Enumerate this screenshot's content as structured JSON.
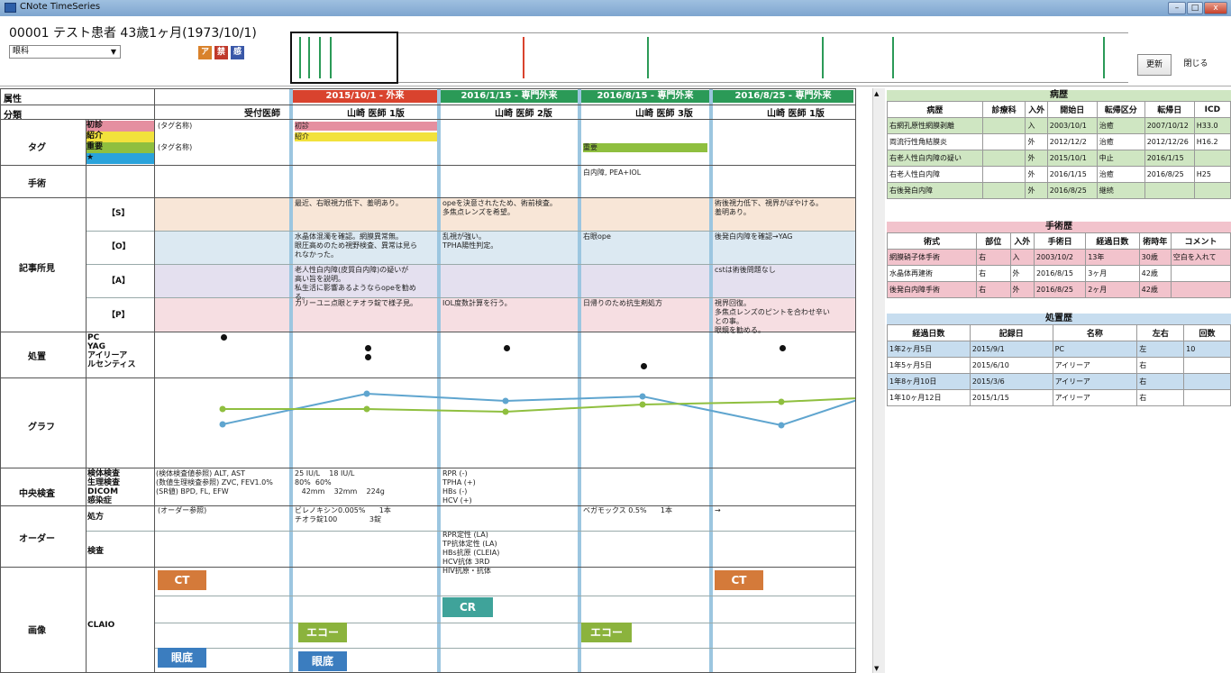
{
  "window": {
    "title": "CNote TimeSeries",
    "min": "–",
    "max": "□",
    "close": "x"
  },
  "patient": {
    "info": "00001 テスト患者 43歳1ヶ月(1973/10/1)",
    "department": "眼科",
    "badges": [
      {
        "label": "ア",
        "color": "#d9822b"
      },
      {
        "label": "禁",
        "color": "#c0392b"
      },
      {
        "label": "感",
        "color": "#3a58a8"
      }
    ]
  },
  "buttons": {
    "update": "更新",
    "close": "閉じる"
  },
  "grid": {
    "attr_label": "属性",
    "category_label": "分類",
    "doctor_col_label": "受付医師",
    "visits": [
      {
        "header": "2015/10/1 - 外来",
        "color": "#d9432e",
        "doctor": "山崎 医師 1版"
      },
      {
        "header": "2016/1/15 - 専門外来",
        "color": "#2b9a57",
        "doctor": "山崎 医師 2版"
      },
      {
        "header": "2016/8/15 - 専門外来",
        "color": "#2b9a57",
        "doctor": "山崎 医師 3版"
      },
      {
        "header": "2016/8/25 - 専門外来",
        "color": "#2b9a57",
        "doctor": "山崎 医師 1版"
      }
    ],
    "sections": {
      "tag": "タグ",
      "surgery": "手術",
      "findings": "記事所見",
      "treatment": "処置",
      "graph": "グラフ",
      "central_exam": "中央検査",
      "order": "オーダー",
      "image": "画像"
    },
    "tag_rows": [
      {
        "label": "初診",
        "color": "#e58fa0",
        "note": "(タグ名称)"
      },
      {
        "label": "紹介",
        "color": "#f2e23c",
        "note": ""
      },
      {
        "label": "重要",
        "color": "#8fbf3f",
        "note": "(タグ名称)"
      },
      {
        "label": "★",
        "color": "#2aa3db",
        "note": ""
      }
    ],
    "soap_rows": [
      "【S】",
      "【O】",
      "【A】",
      "【P】"
    ],
    "treatment_rows": [
      "PC",
      "YAG",
      "アイリーア",
      "ルセンティス"
    ],
    "exam_rows": [
      {
        "label": "検体検査",
        "note": "(検体検査値参照) ALT, AST"
      },
      {
        "label": "生理検査",
        "note": "(数値生理検査参照) ZVC, FEV1.0%"
      },
      {
        "label": "DICOM",
        "note": "(SR値) BPD, FL, EFW"
      },
      {
        "label": "感染症",
        "note": ""
      }
    ],
    "order_rows": [
      "処方",
      "検査"
    ],
    "order_note": "(オーダー参照)",
    "image_row": "CLAIO",
    "cells": {
      "tag_shoshin": "初診",
      "tag_shokai": "紹介",
      "tag_juyo": "重要",
      "surgery_v3": "白内障, PEA+IOL",
      "s_v1": "最近、右眼視力低下、羞明あり。",
      "s_v2": "opeを決意されたため、術前検査。\n多焦点レンズを希望。",
      "s_v4": "術後視力低下、視界がぼやける。\n羞明あり。",
      "o_v1": "水晶体混濁を確認。網膜異常無。\n眼圧高めのため視野検査、異常は見ら\nれなかった。",
      "o_v2": "乱視が強い。\nTPHA陽性判定。",
      "o_v3": "右眼ope",
      "o_v4": "後発白内障を確認→YAG",
      "a_v1": "老人性白内障(皮質白内障)の疑いが\n高い旨を説明。\n私生活に影響あるようならopeを勧め\nる。",
      "a_v3": "cstは術後問題なし",
      "p_v1": "カリーユニ点眼とチオラ錠で様子見。",
      "p_v2": "IOL度数計算を行う。",
      "p_v3": "日帰りのため抗生剤処方",
      "p_v4": "視界回復。\n多焦点レンズのピントを合わせ辛い\nとの事。\n眼鏡を勧める。",
      "exam_v1": "25 IU/L    18 IU/L\n80%  60%\n   42mm    32mm    224g",
      "exam_v2": "RPR (-)\nTPHA (+)\nHBs (-)\nHCV (+)",
      "rx_v1": "ビレノキシン0.005%      1本\nチオラ錠100              3錠",
      "rx_v3": "ベガモックス 0.5%      1本",
      "rx_v4": "→",
      "test_v2": "RPR定性 (LA)\nTP抗体定性 (LA)\nHBs抗原 (CLEIA)\nHCV抗体 3RD\nHIV抗原・抗体"
    },
    "images": [
      {
        "label": "CT",
        "color": "#d47a3a"
      },
      {
        "label": "エコー",
        "color": "#8bb33d"
      },
      {
        "label": "眼底",
        "color": "#3b7dbf"
      },
      {
        "label": "眼底",
        "color": "#3b7dbf"
      },
      {
        "label": "CR",
        "color": "#3fa39a"
      },
      {
        "label": "エコー",
        "color": "#8bb33d"
      },
      {
        "label": "CT",
        "color": "#d47a3a"
      }
    ]
  },
  "history": {
    "title": "病歴",
    "color": "#cfe6c2",
    "headers": [
      "病歴",
      "診療科",
      "入外",
      "開始日",
      "転帰区分",
      "転帰日",
      "ICD"
    ],
    "rows": [
      [
        "右網孔原性網膜剥離",
        "",
        "入",
        "2003/10/1",
        "治癒",
        "2007/10/12",
        "H33.0"
      ],
      [
        "両流行性角結膜炎",
        "",
        "外",
        "2012/12/2",
        "治癒",
        "2012/12/26",
        "H16.2"
      ],
      [
        "右老人性白内障の疑い",
        "",
        "外",
        "2015/10/1",
        "中止",
        "2016/1/15",
        ""
      ],
      [
        "右老人性白内障",
        "",
        "外",
        "2016/1/15",
        "治癒",
        "2016/8/25",
        "H25"
      ],
      [
        "右後発白内障",
        "",
        "外",
        "2016/8/25",
        "継続",
        "",
        ""
      ]
    ]
  },
  "surgery_history": {
    "title": "手術歴",
    "color": "#f2c3cc",
    "headers": [
      "術式",
      "部位",
      "入外",
      "手術日",
      "経過日数",
      "術時年",
      "コメント"
    ],
    "rows": [
      [
        "網膜硝子体手術",
        "右",
        "入",
        "2003/10/2",
        "13年",
        "30歳",
        "空白を入れて"
      ],
      [
        "水晶体再建術",
        "右",
        "外",
        "2016/8/15",
        "3ヶ月",
        "42歳",
        ""
      ],
      [
        "後発白内障手術",
        "右",
        "外",
        "2016/8/25",
        "2ヶ月",
        "42歳",
        ""
      ]
    ]
  },
  "treatment_history": {
    "title": "処置歴",
    "color": "#c7ddef",
    "headers": [
      "経過日数",
      "記録日",
      "名称",
      "左右",
      "回数"
    ],
    "rows": [
      [
        "1年2ヶ月5日",
        "2015/9/1",
        "PC",
        "左",
        "10"
      ],
      [
        "1年5ヶ月5日",
        "2015/6/10",
        "アイリーア",
        "右",
        ""
      ],
      [
        "1年8ヶ月10日",
        "2015/3/6",
        "アイリーア",
        "右",
        ""
      ],
      [
        "1年10ヶ月12日",
        "2015/1/15",
        "アイリーア",
        "右",
        ""
      ]
    ]
  },
  "graph": {
    "blue_series": [
      0.48,
      0.82,
      0.74,
      0.79,
      0.47,
      0.75
    ],
    "green_series": [
      0.65,
      0.65,
      0.62,
      0.7,
      0.73,
      0.77
    ]
  }
}
